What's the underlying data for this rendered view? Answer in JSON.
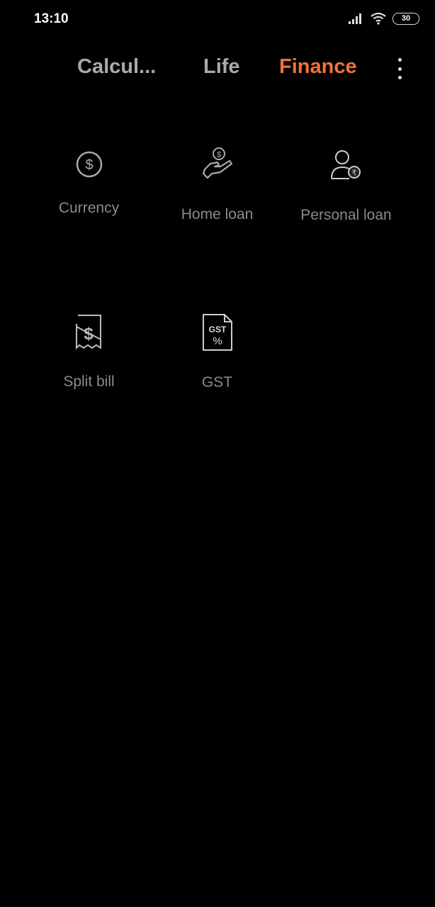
{
  "status_bar": {
    "time": "13:10",
    "battery": "30",
    "icons": [
      "signal-icon",
      "wifi-icon",
      "battery-icon"
    ]
  },
  "tabs": [
    {
      "label": "Calcul...",
      "active": false
    },
    {
      "label": "Life",
      "active": false
    },
    {
      "label": "Finance",
      "active": true
    }
  ],
  "accent_color": "#f07338",
  "tools": [
    {
      "label": "Currency",
      "icon": "dollar-circle-icon"
    },
    {
      "label": "Home loan",
      "icon": "hand-coin-icon"
    },
    {
      "label": "Personal loan",
      "icon": "person-rupee-icon"
    },
    {
      "label": "Split bill",
      "icon": "split-receipt-icon"
    },
    {
      "label": "GST",
      "icon": "gst-document-icon",
      "icon_text": "GST",
      "icon_symbol": "%"
    }
  ]
}
